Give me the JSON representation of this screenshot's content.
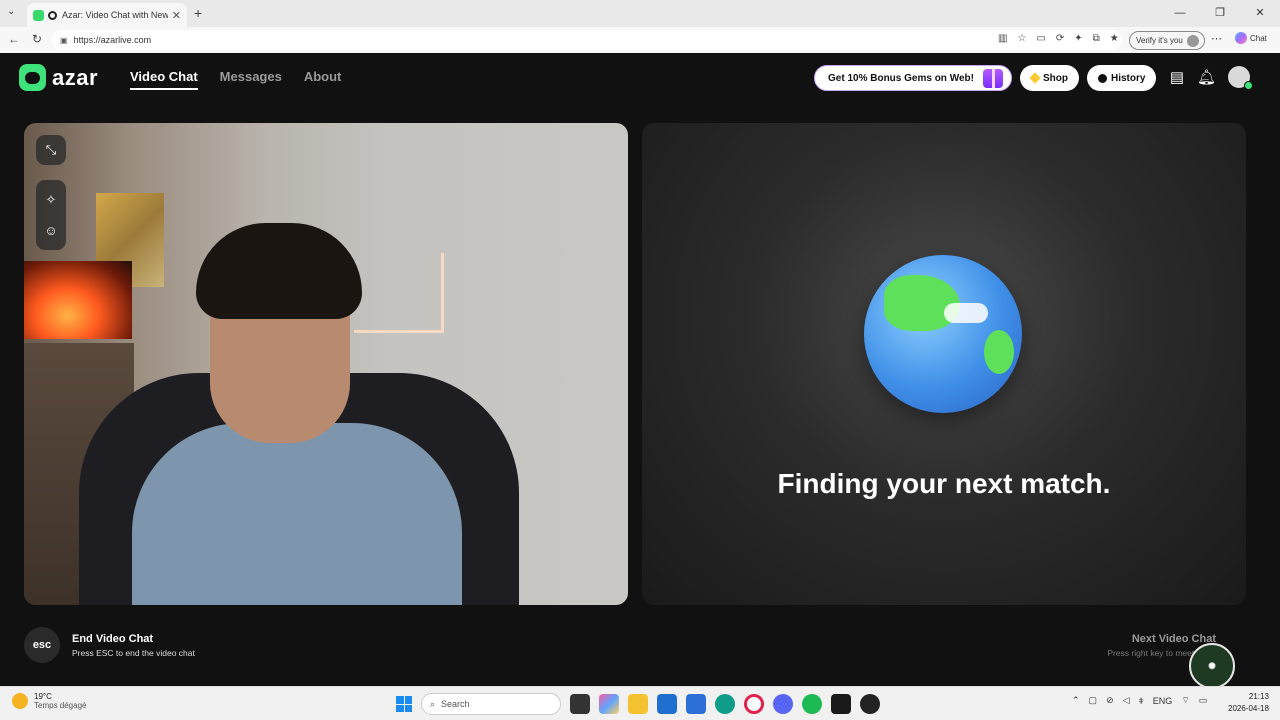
{
  "browser": {
    "tab_title": "Azar: Video Chat with New Pe",
    "url": "https://azarlive.com",
    "profile_button": "Verify it's you",
    "copilot_label": "Chat"
  },
  "header": {
    "logo_text": "azar",
    "nav": [
      {
        "label": "Video Chat",
        "active": true
      },
      {
        "label": "Messages",
        "active": false
      },
      {
        "label": "About",
        "active": false
      }
    ],
    "promo_label": "Get 10% Bonus Gems on Web!",
    "shop_label": "Shop",
    "history_label": "History"
  },
  "match_panel": {
    "status_text": "Finding your next match."
  },
  "footer": {
    "esc_key": "esc",
    "end_title": "End Video Chat",
    "end_sub": "Press ESC to end the video chat",
    "next_title": "Next Video Chat",
    "next_sub": "Press right key to meet other"
  },
  "taskbar": {
    "temp": "19°C",
    "weather": "Temps dégagé",
    "search_placeholder": "Search",
    "lang": "ENG",
    "time": "21:13",
    "date": "2026-04-18"
  },
  "colors": {
    "brand_green": "#3ee27a",
    "background": "#111111"
  }
}
